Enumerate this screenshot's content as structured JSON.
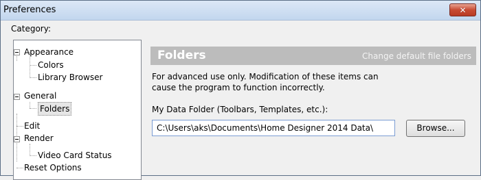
{
  "window": {
    "title": "Preferences",
    "close_glyph": "✕"
  },
  "category_label": "Category:",
  "tree": [
    {
      "label": "Appearance"
    },
    {
      "label": "Colors"
    },
    {
      "label": "Library Browser"
    },
    {
      "label": "General"
    },
    {
      "label": "Folders",
      "selected": true
    },
    {
      "label": "Edit"
    },
    {
      "label": "Render"
    },
    {
      "label": "Video Card Status"
    },
    {
      "label": "Reset Options"
    }
  ],
  "panel": {
    "title": "Folders",
    "subtitle": "Change default file folders",
    "description": "For advanced use only. Modification of these items can cause the program to function incorrectly.",
    "data_folder_label": "My Data Folder (Toolbars, Templates, etc.):",
    "data_folder_value": "C:\\Users\\aks\\Documents\\Home Designer 2014 Data\\",
    "browse_label": "Browse..."
  },
  "colors": {
    "header_bg": "#bcbcbc",
    "close_bg": "#c84b33"
  }
}
